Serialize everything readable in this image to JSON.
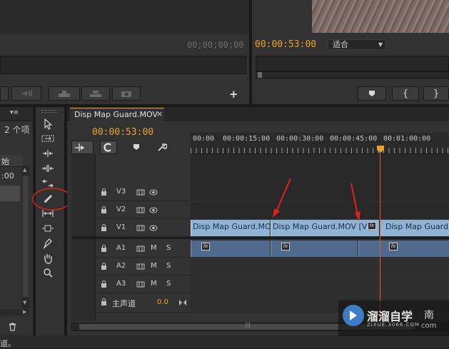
{
  "source_monitor": {
    "timecode": "00;00;00;00"
  },
  "program_monitor": {
    "timecode": "00:00:53:00",
    "fit_select": "适合"
  },
  "project_panel": {
    "item_count": "2 个项",
    "list_fragment_1": "始",
    "list_fragment_2": ":00"
  },
  "sequence_tab": {
    "title": "Disp Map Guard.MOV",
    "close": "×"
  },
  "timeline": {
    "timecode": "00:00:53:00",
    "ruler": [
      "00:00",
      "00:00:15:00",
      "00:00:30:00",
      "00:00:45:00",
      "00:01:00:00"
    ],
    "video_tracks": [
      "V3",
      "V2",
      "V1"
    ],
    "audio_tracks": [
      "A1",
      "A2",
      "A3"
    ],
    "master": {
      "label": "主声道",
      "value": "0.0"
    },
    "clips": [
      "Disp Map Guard.MOV",
      "Disp Map Guard.MOV [V]",
      "Disp Map Guard.MOV"
    ],
    "fx_label": "fx",
    "mute": "M",
    "solo": "S"
  },
  "status_bar": {
    "text": "道。"
  },
  "watermark": {
    "brand": "溜溜自学",
    "suffix": "南",
    "url": "ZIXUE.3066.COM",
    "url2": "com"
  },
  "colors": {
    "timecode": "#e8a42a",
    "clip_video": "#8fb4d6",
    "clip_audio": "#506a8d",
    "playhead": "#e05a30",
    "annotation": "#e02222"
  }
}
